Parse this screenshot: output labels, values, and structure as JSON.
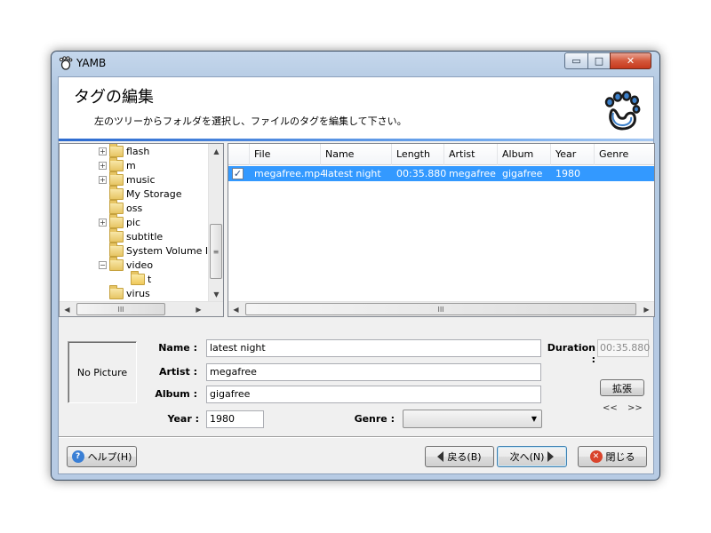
{
  "window": {
    "title": "YAMB",
    "minimize_glyph": "▭",
    "maximize_glyph": "□",
    "close_glyph": "✕"
  },
  "header": {
    "title": "タグの編集",
    "description": "左のツリーからフォルダを選択し、ファイルのタグを編集して下さい。"
  },
  "tree": {
    "items": [
      {
        "label": "flash",
        "expandable": true,
        "expander": "+"
      },
      {
        "label": "m",
        "expandable": true,
        "expander": "+"
      },
      {
        "label": "music",
        "expandable": true,
        "expander": "+"
      },
      {
        "label": "My Storage",
        "expandable": false
      },
      {
        "label": "oss",
        "expandable": false
      },
      {
        "label": "pic",
        "expandable": true,
        "expander": "+"
      },
      {
        "label": "subtitle",
        "expandable": false
      },
      {
        "label": "System Volume In",
        "expandable": false
      },
      {
        "label": "video",
        "expandable": true,
        "expander": "−",
        "expanded": true
      },
      {
        "label": "t",
        "expandable": false,
        "child": true,
        "selected": true
      },
      {
        "label": "virus",
        "expandable": false
      }
    ],
    "scroll_grip": "≡",
    "hscroll_grip": "III",
    "arrow_up": "▲",
    "arrow_down": "▼",
    "arrow_left": "◀",
    "arrow_right": "▶"
  },
  "file_list": {
    "columns": [
      "File",
      "Name",
      "Length",
      "Artist",
      "Album",
      "Year",
      "Genre"
    ],
    "rows": [
      {
        "checked": true,
        "check_glyph": "✓",
        "file": "megafree.mp4",
        "name": "latest night",
        "length": "00:35.880",
        "artist": "megafree",
        "album": "gigafree",
        "year": "1980",
        "genre": ""
      }
    ],
    "hscroll_grip": "III"
  },
  "detail": {
    "picture_placeholder": "No Picture",
    "name_label": "Name :",
    "name_value": "latest night",
    "artist_label": "Artist :",
    "artist_value": "megafree",
    "album_label": "Album :",
    "album_value": "gigafree",
    "year_label": "Year :",
    "year_value": "1980",
    "genre_label": "Genre :",
    "genre_value": "",
    "duration_label": "Duration :",
    "duration_value": "00:35.880",
    "expand_button": "拡張",
    "prev_arrows": "<<",
    "next_arrows": ">>"
  },
  "footer": {
    "help_button": "ヘルプ(H)",
    "back_button": "戻る(B)",
    "next_button": "次へ(N)",
    "close_button": "閉じる"
  },
  "colors": {
    "selection": "#3399ff",
    "help_icon": "#3a7fd5",
    "close_icon": "#d9442c"
  }
}
